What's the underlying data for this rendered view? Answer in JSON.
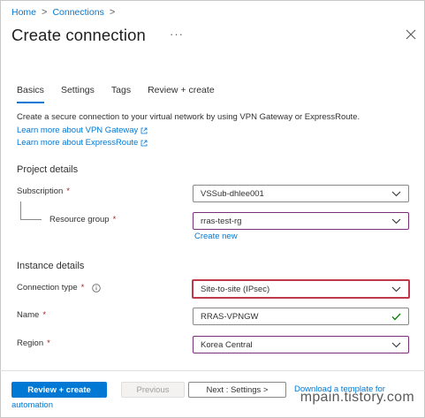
{
  "breadcrumb": {
    "home": "Home",
    "connections": "Connections",
    "separator": ">"
  },
  "page": {
    "title": "Create connection",
    "more": "···"
  },
  "tabs": [
    {
      "label": "Basics",
      "active": true
    },
    {
      "label": "Settings"
    },
    {
      "label": "Tags"
    },
    {
      "label": "Review + create"
    }
  ],
  "intro": {
    "description": "Create a secure connection to your virtual network by using VPN Gateway or ExpressRoute.",
    "link_vpn": "Learn more about VPN Gateway",
    "link_er": "Learn more about ExpressRoute"
  },
  "project": {
    "heading": "Project details",
    "subscription_label": "Subscription",
    "subscription_value": "VSSub-dhlee001",
    "rg_label": "Resource group",
    "rg_value": "rras-test-rg",
    "create_new": "Create new"
  },
  "instance": {
    "heading": "Instance details",
    "conn_type_label": "Connection type",
    "conn_type_value": "Site-to-site (IPsec)",
    "name_label": "Name",
    "name_value": "RRAS-VPNGW",
    "region_label": "Region",
    "region_value": "Korea Central"
  },
  "required_mark": "*",
  "footer": {
    "review": "Review + create",
    "previous": "Previous",
    "next": "Next : Settings >",
    "download_1": "Download a template for",
    "download_2": "automation"
  },
  "watermark": "mpain.tistory.com",
  "colors": {
    "accent": "#0078d4",
    "required": "#a4262c",
    "highlight": "#c0394b",
    "purple_border": "#7a2f77"
  }
}
